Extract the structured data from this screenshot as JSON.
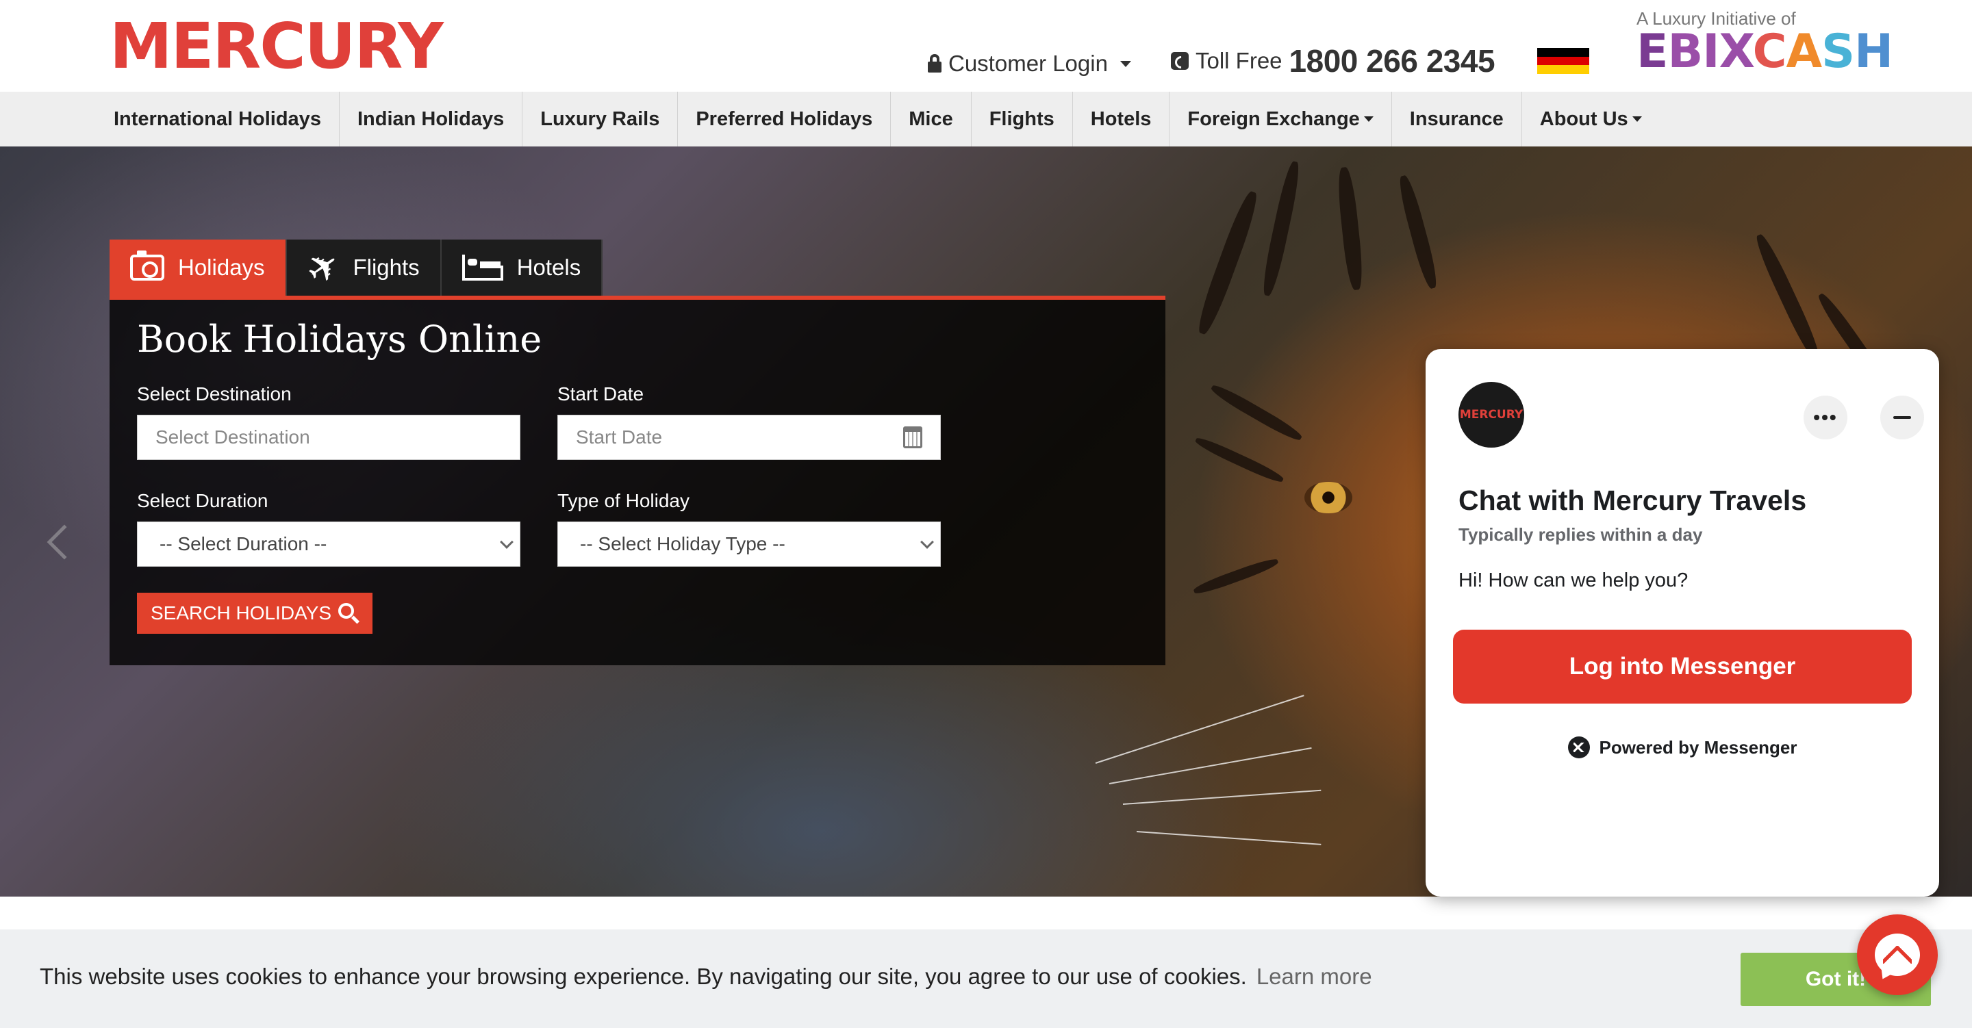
{
  "header": {
    "logo": "MERCURY",
    "customer_login": "Customer Login",
    "toll_free_label": "Toll Free",
    "toll_free_number": "1800 266 2345",
    "initiative": "A Luxury Initiative of",
    "partner_logo": "EBIXCASH"
  },
  "nav": {
    "items": [
      {
        "label": "International Holidays"
      },
      {
        "label": "Indian Holidays"
      },
      {
        "label": "Luxury Rails"
      },
      {
        "label": "Preferred Holidays"
      },
      {
        "label": "Mice"
      },
      {
        "label": "Flights"
      },
      {
        "label": "Hotels"
      },
      {
        "label": "Foreign Exchange"
      },
      {
        "label": "Insurance"
      },
      {
        "label": "About Us"
      }
    ]
  },
  "booking": {
    "tabs": [
      {
        "label": "Holidays",
        "icon": "camera-icon"
      },
      {
        "label": "Flights",
        "icon": "plane-icon"
      },
      {
        "label": "Hotels",
        "icon": "bed-icon"
      }
    ],
    "title": "Book Holidays Online",
    "destination_label": "Select Destination",
    "destination_placeholder": "Select Destination",
    "start_date_label": "Start Date",
    "start_date_placeholder": "Start Date",
    "duration_label": "Select Duration",
    "duration_value": "-- Select Duration --",
    "holiday_type_label": "Type of Holiday",
    "holiday_type_value": "-- Select Holiday Type --",
    "search_button": "SEARCH HOLIDAYS"
  },
  "chat": {
    "avatar_text": "MERCURY",
    "title": "Chat with Mercury Travels",
    "subtitle": "Typically replies within a day",
    "greeting": "Hi! How can we help you?",
    "login_button": "Log into Messenger",
    "powered_by": "Powered by Messenger"
  },
  "cookie": {
    "message": "This website uses cookies to enhance your browsing experience. By navigating our site, you agree to our use of cookies.",
    "learn_more": "Learn more",
    "accept_button": "Got it!"
  },
  "colors": {
    "brand_red": "#e0403a",
    "accent_red": "#e1412c",
    "messenger_red": "#e3382b",
    "cookie_green": "#8cc055",
    "flag": [
      "#000000",
      "#dd0000",
      "#ffce00"
    ]
  }
}
